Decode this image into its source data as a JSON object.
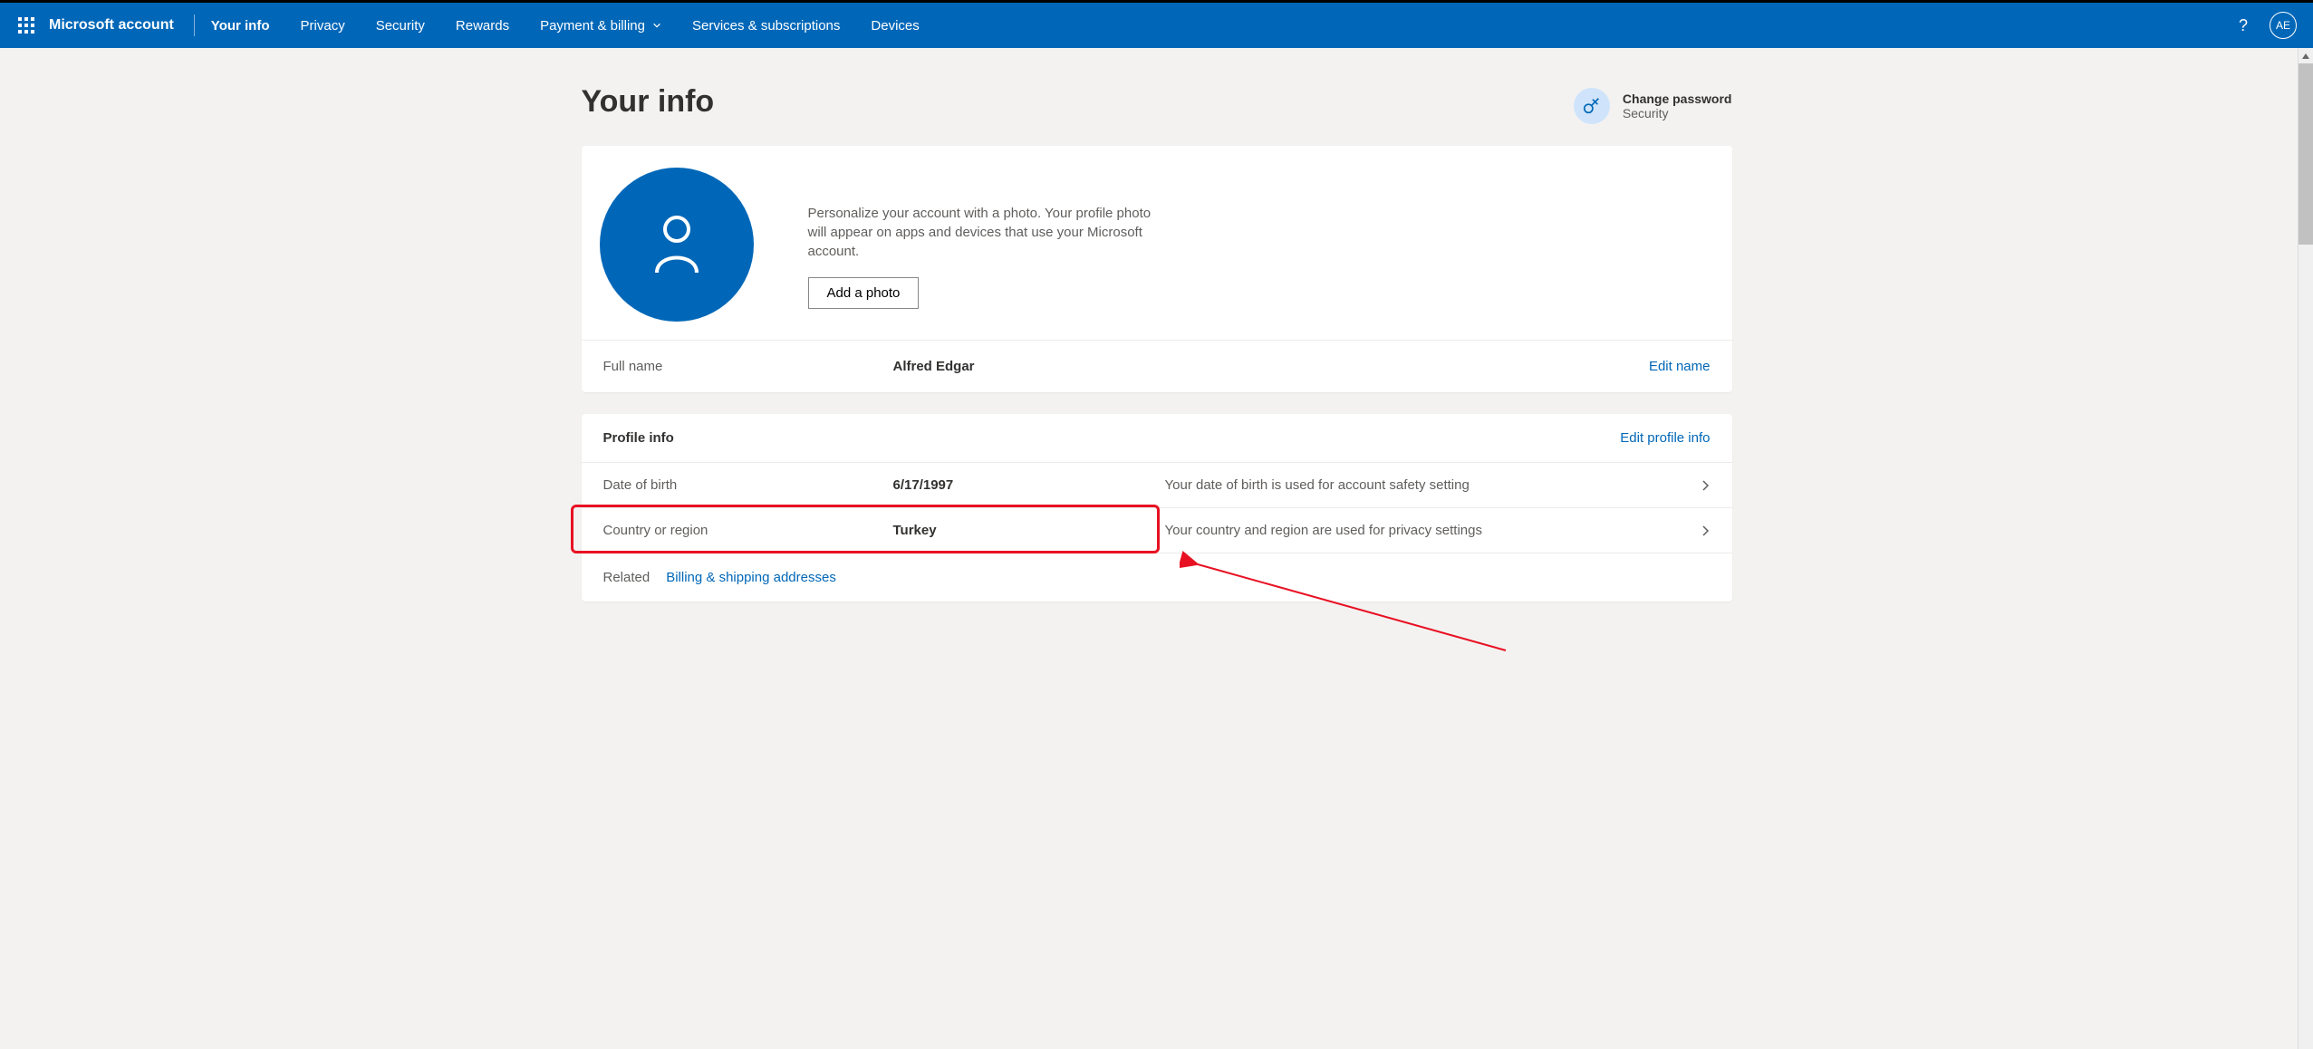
{
  "header": {
    "brand": "Microsoft account",
    "nav": [
      {
        "label": "Your info",
        "active": true
      },
      {
        "label": "Privacy"
      },
      {
        "label": "Security"
      },
      {
        "label": "Rewards"
      },
      {
        "label": "Payment & billing",
        "dropdown": true
      },
      {
        "label": "Services & subscriptions"
      },
      {
        "label": "Devices"
      }
    ],
    "avatar_initials": "AE"
  },
  "page": {
    "title": "Your info",
    "change_password": {
      "title": "Change password",
      "sub": "Security"
    }
  },
  "photo_card": {
    "desc": "Personalize your account with a photo. Your profile photo will appear on apps and devices that use your Microsoft account.",
    "button": "Add a photo"
  },
  "name_row": {
    "label": "Full name",
    "value": "Alfred Edgar",
    "edit": "Edit name"
  },
  "profile_card": {
    "title": "Profile info",
    "edit": "Edit profile info",
    "rows": [
      {
        "label": "Date of birth",
        "value": "6/17/1997",
        "desc": "Your date of birth is used for account safety setting"
      },
      {
        "label": "Country or region",
        "value": "Turkey",
        "desc": "Your country and region are used for privacy settings"
      }
    ],
    "related_label": "Related",
    "related_link": "Billing & shipping addresses"
  }
}
